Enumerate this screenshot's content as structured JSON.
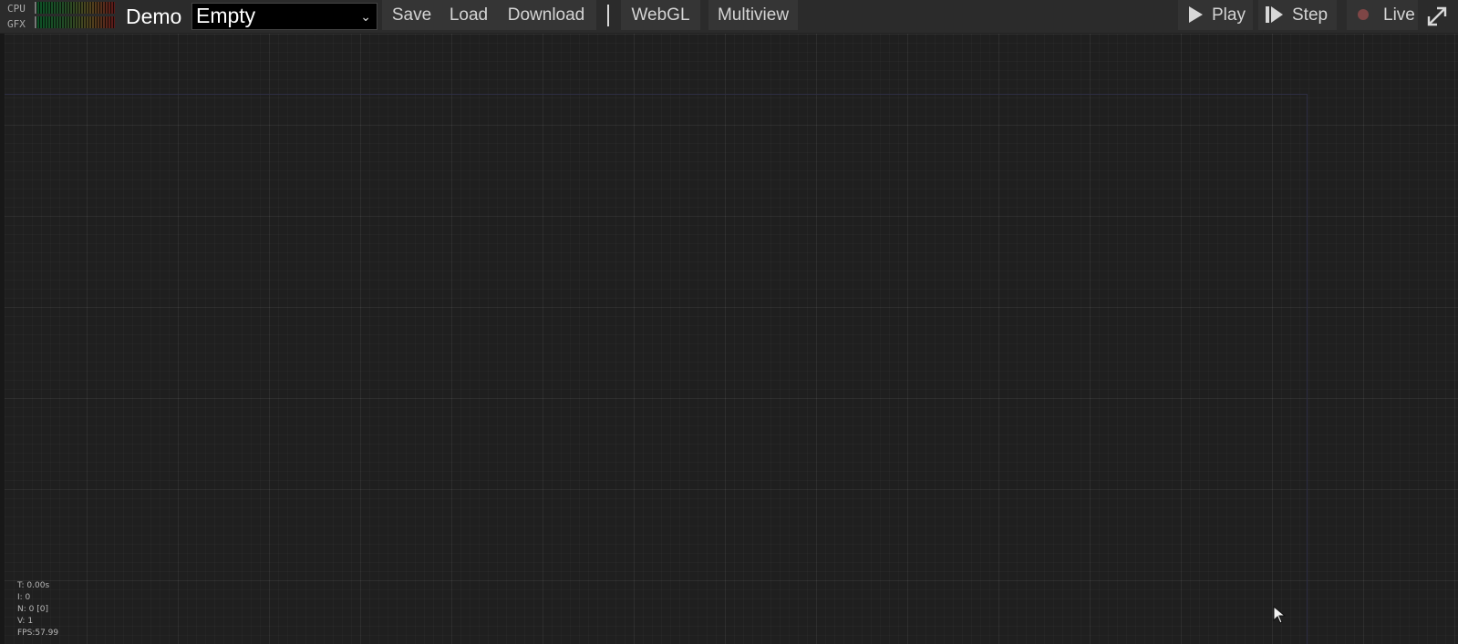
{
  "meters": {
    "cpu_label": "CPU",
    "gfx_label": "GFX"
  },
  "toolbar": {
    "title": "Demo",
    "selected_demo": "Empty",
    "save_label": "Save",
    "load_label": "Load",
    "download_label": "Download",
    "webgl_label": "WebGL",
    "multiview_label": "Multiview",
    "play_label": "Play",
    "step_label": "Step",
    "live_label": "Live"
  },
  "icons": {
    "play": "play-icon",
    "step": "step-icon",
    "live": "record-dot-icon",
    "expand": "expand-icon",
    "chevron": "chevron-down-icon",
    "cursor": "mouse-cursor-icon"
  },
  "stats": {
    "time": "T: 0.00s",
    "iterations": "I: 0",
    "nodes": "N: 0 [0]",
    "views": "V: 1",
    "fps": "FPS:57.99"
  },
  "colors": {
    "background": "#1e1f1f",
    "toolbar": "#2b2b2b",
    "button": "#353535",
    "live_dot": "#7e4646",
    "frame": "#2d2e43"
  }
}
